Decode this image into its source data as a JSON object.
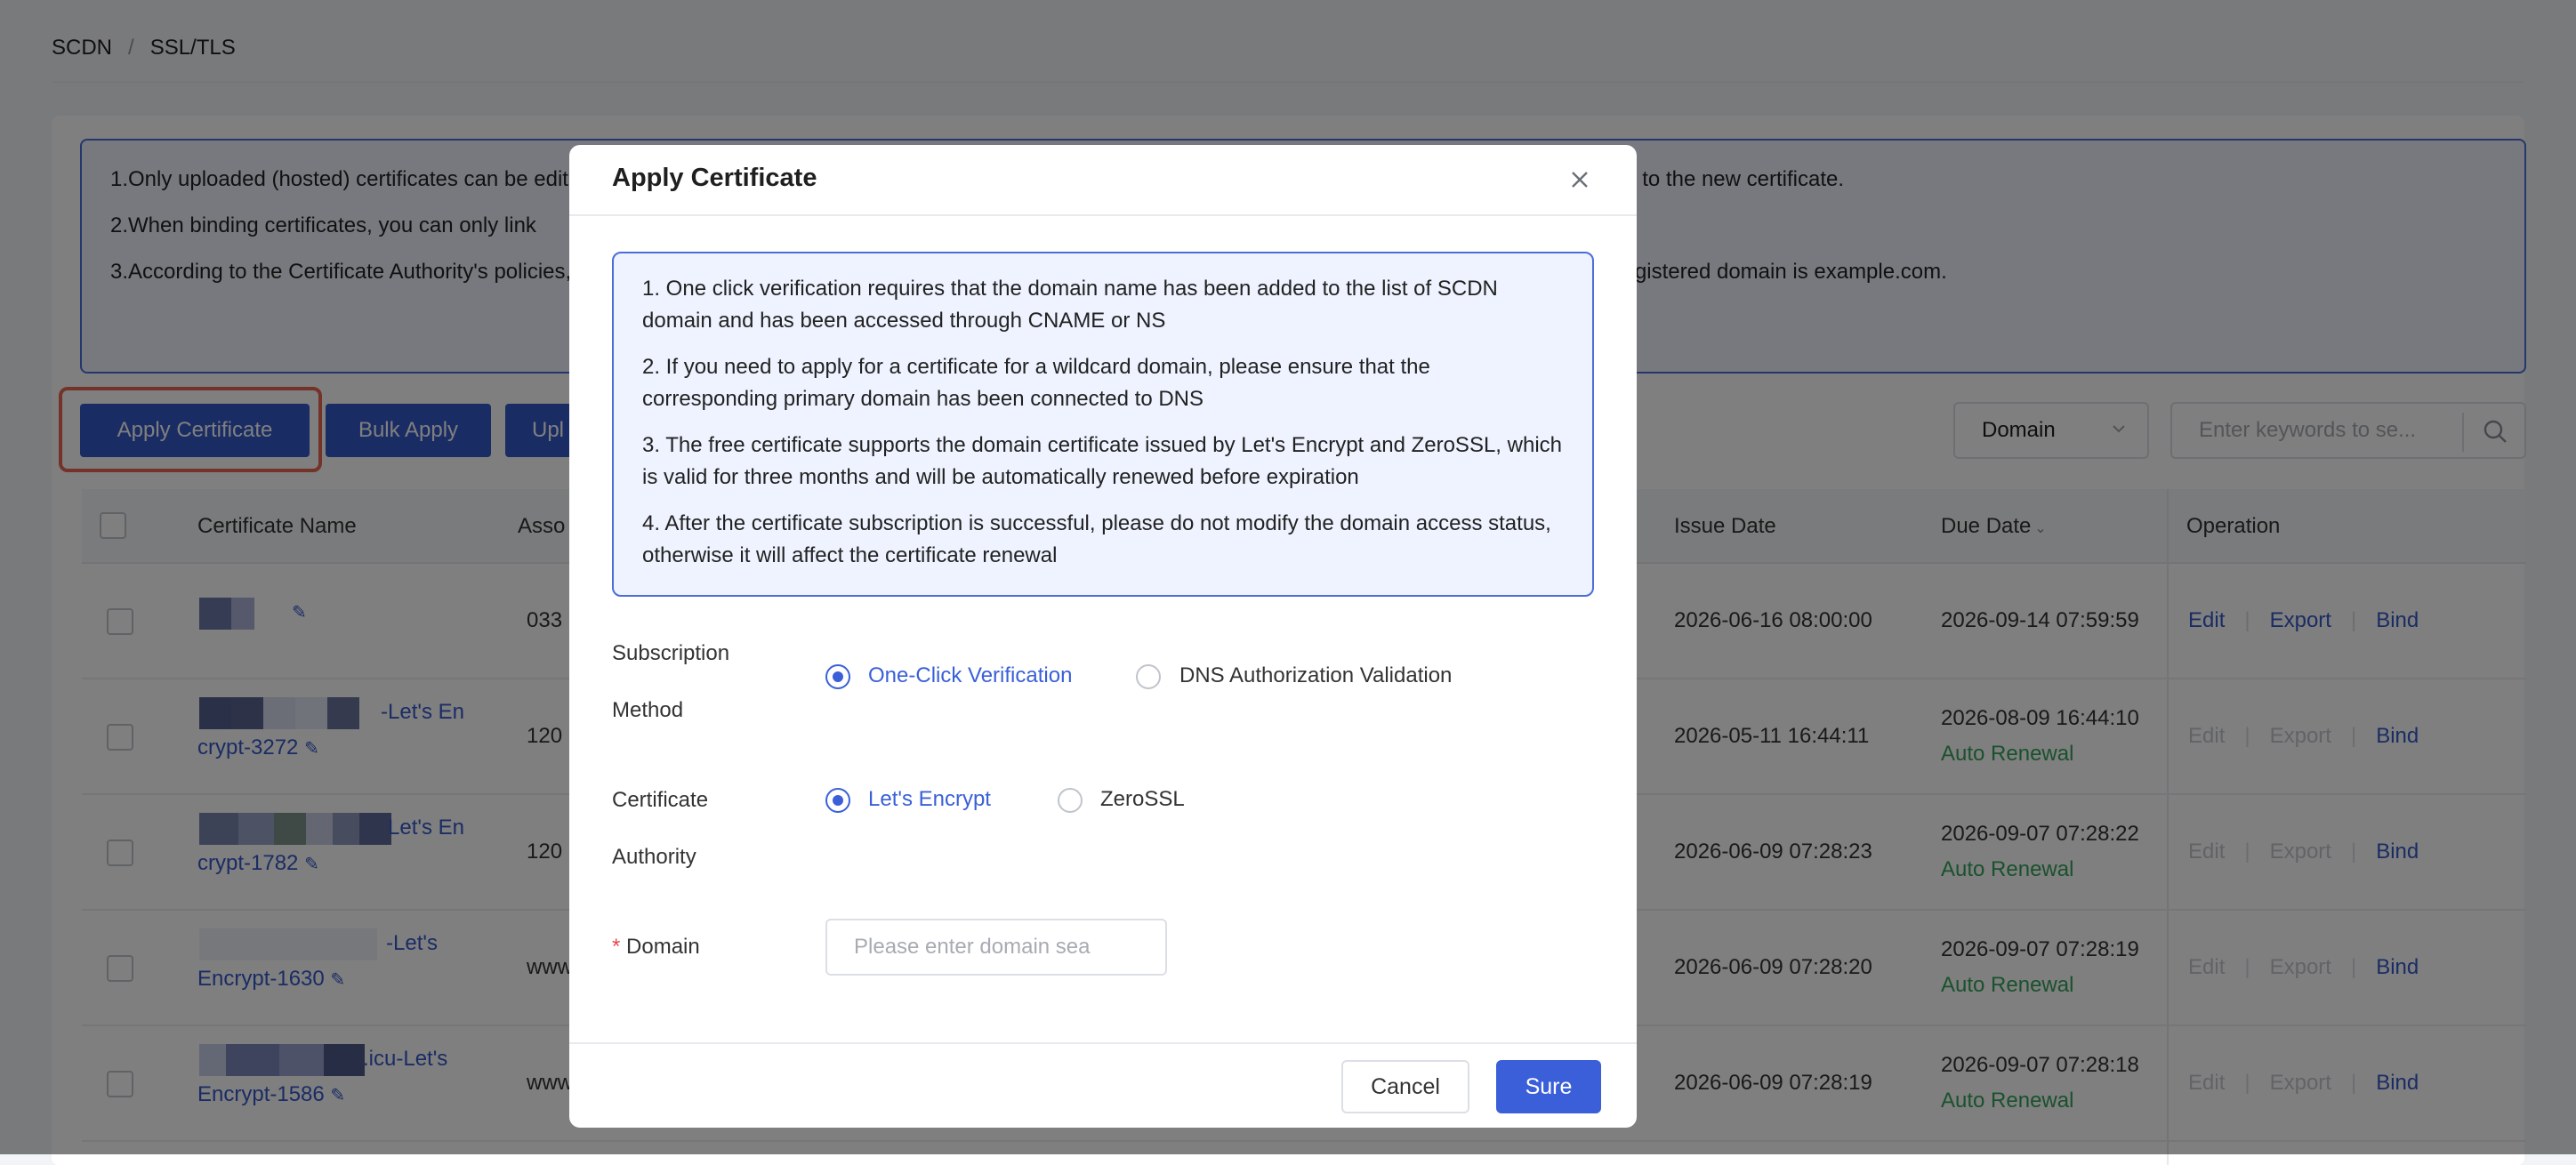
{
  "breadcrumb": {
    "root": "SCDN",
    "separator": "/",
    "current": "SSL/TLS"
  },
  "notice": {
    "line1": "1.Only uploaded (hosted) certificates can be edited. When editing a certificate, please upload a valid certificate. After saving, the domains will automatically switch to the new certificate.",
    "line2": "2.When binding certificates, you can only link",
    "line3": "3.According to the Certificate Authority's policies, Let's Encrypt certificates allow up to 5 duplicate certificates per week. For example, in www.example.com, the registered domain is example.com."
  },
  "toolbar": {
    "apply_label": "Apply Certificate",
    "bulk_label": "Bulk Apply",
    "upload_label": "Upl",
    "filter_value": "Domain",
    "search_placeholder": "Enter keywords to se..."
  },
  "table": {
    "headers": {
      "name": "Certificate Name",
      "assoc": "Asso",
      "issue": "Issue Date",
      "due": "Due Date",
      "operation": "Operation"
    },
    "actions": {
      "edit": "Edit",
      "export": "Export",
      "bind": "Bind"
    },
    "rows": [
      {
        "name_line1": "",
        "name_line2": "",
        "assoc": "033",
        "issue": "2026-06-16 08:00:00",
        "due": "2026-09-14 07:59:59",
        "renewal": "",
        "edit_enabled": true
      },
      {
        "name_line1": "-Let's En",
        "name_line2": "crypt-3272",
        "assoc": "120",
        "issue": "2026-05-11 16:44:11",
        "due": "2026-08-09 16:44:10",
        "renewal": "Auto Renewal",
        "edit_enabled": false
      },
      {
        "name_line1": "Let's En",
        "name_line2": "crypt-1782",
        "assoc": "120",
        "issue": "2026-06-09 07:28:23",
        "due": "2026-09-07 07:28:22",
        "renewal": "Auto Renewal",
        "edit_enabled": false
      },
      {
        "name_line1": "-Let's",
        "name_line2": "Encrypt-1630",
        "assoc": "www",
        "issue": "2026-06-09 07:28:20",
        "due": "2026-09-07 07:28:19",
        "renewal": "Auto Renewal",
        "edit_enabled": false
      },
      {
        "name_line1": ".icu-Let's",
        "name_line2": "Encrypt-1586",
        "assoc": "www",
        "issue": "2026-06-09 07:28:19",
        "due": "2026-09-07 07:28:18",
        "renewal": "Auto Renewal",
        "edit_enabled": false
      }
    ]
  },
  "modal": {
    "title": "Apply Certificate",
    "notes": [
      "1. One click verification requires that the domain name has been added to the list of SCDN domain and has been accessed through CNAME or NS",
      "2. If you need to apply for a certificate for a wildcard domain, please ensure that the corresponding primary domain has been connected to DNS",
      "3. The free certificate supports the domain certificate issued by Let's Encrypt and ZeroSSL, which is valid for three months and will be automatically renewed before expiration",
      "4. After the certificate subscription is successful, please do not modify the domain access status, otherwise it will affect the certificate renewal"
    ],
    "subscription_label_1": "Subscription",
    "subscription_label_2": "Method",
    "subscription_options": [
      "One-Click Verification",
      "DNS Authorization Validation"
    ],
    "authority_label_1": "Certificate",
    "authority_label_2": "Authority",
    "authority_options": [
      "Let's Encrypt",
      "ZeroSSL"
    ],
    "required_mark": "*",
    "domain_label": "Domain",
    "domain_placeholder": "Please enter domain sea",
    "cancel_label": "Cancel",
    "sure_label": "Sure"
  },
  "colors": {
    "accent": "#3458c9",
    "highlight": "#e86652",
    "success": "#34a35a"
  }
}
